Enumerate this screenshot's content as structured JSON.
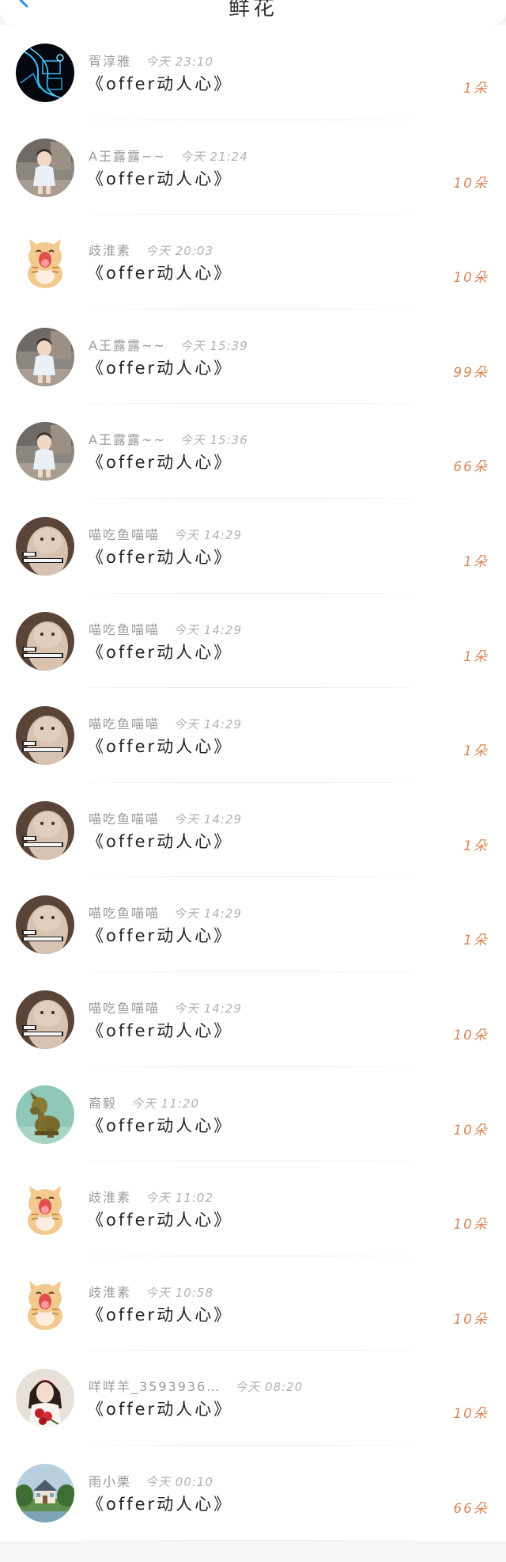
{
  "header": {
    "title": "鲜花",
    "back_icon": "chevron-left-icon"
  },
  "colors": {
    "count": "#d7875a",
    "name": "#9a9a9a",
    "time": "#b2b2b2",
    "back": "#2f8bf5"
  },
  "items": [
    {
      "name": "胥淳雅",
      "time": "今天 23:10",
      "title": "《offer动人心》",
      "count": "1朵",
      "avatar": "neon-scene"
    },
    {
      "name": "A王露露~~",
      "time": "今天 21:24",
      "title": "《offer动人心》",
      "count": "10朵",
      "avatar": "child-photo"
    },
    {
      "name": "歧淮素",
      "time": "今天 20:03",
      "title": "《offer动人心》",
      "count": "10朵",
      "avatar": "tiger-cat-cartoon"
    },
    {
      "name": "A王露露~~",
      "time": "今天 15:39",
      "title": "《offer动人心》",
      "count": "99朵",
      "avatar": "child-photo"
    },
    {
      "name": "A王露露~~",
      "time": "今天 15:36",
      "title": "《offer动人心》",
      "count": "66朵",
      "avatar": "child-photo"
    },
    {
      "name": "喵吃鱼喵喵",
      "time": "今天 14:29",
      "title": "《offer动人心》",
      "count": "1朵",
      "avatar": "cat-meme"
    },
    {
      "name": "喵吃鱼喵喵",
      "time": "今天 14:29",
      "title": "《offer动人心》",
      "count": "1朵",
      "avatar": "cat-meme"
    },
    {
      "name": "喵吃鱼喵喵",
      "time": "今天 14:29",
      "title": "《offer动人心》",
      "count": "1朵",
      "avatar": "cat-meme"
    },
    {
      "name": "喵吃鱼喵喵",
      "time": "今天 14:29",
      "title": "《offer动人心》",
      "count": "1朵",
      "avatar": "cat-meme"
    },
    {
      "name": "喵吃鱼喵喵",
      "time": "今天 14:29",
      "title": "《offer动人心》",
      "count": "1朵",
      "avatar": "cat-meme"
    },
    {
      "name": "喵吃鱼喵喵",
      "time": "今天 14:29",
      "title": "《offer动人心》",
      "count": "10朵",
      "avatar": "cat-meme"
    },
    {
      "name": "裔毅",
      "time": "今天 11:20",
      "title": "《offer动人心》",
      "count": "10朵",
      "avatar": "bronze-dog"
    },
    {
      "name": "歧淮素",
      "time": "今天 11:02",
      "title": "《offer动人心》",
      "count": "10朵",
      "avatar": "tiger-cat-cartoon"
    },
    {
      "name": "歧淮素",
      "time": "今天 10:58",
      "title": "《offer动人心》",
      "count": "10朵",
      "avatar": "tiger-cat-cartoon"
    },
    {
      "name": "咩咩羊_3593936…",
      "time": "今天 08:20",
      "title": "《offer动人心》",
      "count": "10朵",
      "avatar": "woman-with-roses"
    },
    {
      "name": "雨小栗",
      "time": "今天 00:10",
      "title": "《offer动人心》",
      "count": "66朵",
      "avatar": "house-landscape"
    }
  ]
}
